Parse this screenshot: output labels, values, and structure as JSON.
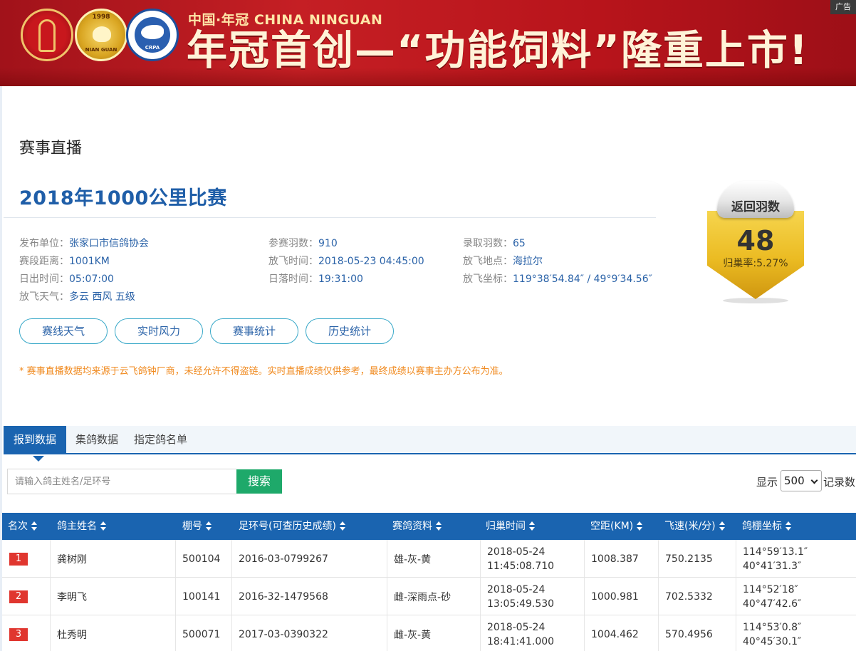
{
  "banner": {
    "subtitle": "中国·年冠 CHINA NINGUAN",
    "headline": "年冠首创—“功能饲料”隆重上市!",
    "ad_label": "广告",
    "logo2_year": "1998",
    "logo2_text": "NIAN GUAN",
    "logo3_text": "CRPA"
  },
  "section_title": "赛事直播",
  "race_title": "2018年1000公里比赛",
  "info": {
    "publisher_label": "发布单位：",
    "publisher": "张家口市信鸽协会",
    "entries_label": "参赛羽数：",
    "entries": "910",
    "winners_label": "录取羽数：",
    "winners": "65",
    "distance_label": "赛段距离：",
    "distance": "1001KM",
    "release_time_label": "放飞时间：",
    "release_time": "2018-05-23 04:45:00",
    "release_place_label": "放飞地点：",
    "release_place": "海拉尔",
    "sunrise_label": "日出时间：",
    "sunrise": "05:07:00",
    "sunset_label": "日落时间：",
    "sunset": "19:31:00",
    "coords_label": "放飞坐标：",
    "coords": "119°38′54.84″ / 49°9′34.56″",
    "weather_label": "放飞天气：",
    "weather": "多云 西风 五级"
  },
  "badge": {
    "label": "返回羽数",
    "count": "48",
    "rate": "归巢率:5.27%",
    "fill_percent": 5.27
  },
  "buttons": [
    "赛线天气",
    "实时风力",
    "赛事统计",
    "历史统计"
  ],
  "notice": "* 赛事直播数据均来源于云飞鸽钟厂商，未经允许不得盗链。实时直播成绩仅供参考，最终成绩以赛事主办方公布为准。",
  "tabs": [
    "报到数据",
    "集鸽数据",
    "指定鸽名单"
  ],
  "search": {
    "placeholder": "请输入鸽主姓名/足环号",
    "button": "搜索",
    "show_label": "显示",
    "show_value": "500",
    "records_label": "记录数"
  },
  "table": {
    "headers": [
      "名次",
      "鸽主姓名",
      "棚号",
      "足环号(可查历史成绩)",
      "赛鸽资料",
      "归巢时间",
      "空距(KM)",
      "飞速(米/分)",
      "鸽棚坐标"
    ],
    "rows": [
      {
        "rank": "1",
        "name": "龚树刚",
        "loft": "500104",
        "ring": "2016-03-0799267",
        "pigeon": "雄-灰-黄",
        "date": "2018-05-24",
        "time": "11:45:08.710",
        "distance": "1008.387",
        "speed": "750.2135",
        "lon": "114°59′13.1″",
        "lat": "40°41′31.3″"
      },
      {
        "rank": "2",
        "name": "李明飞",
        "loft": "100141",
        "ring": "2016-32-1479568",
        "pigeon": "雌-深雨点-砂",
        "date": "2018-05-24",
        "time": "13:05:49.530",
        "distance": "1000.981",
        "speed": "702.5332",
        "lon": "114°52′18″",
        "lat": "40°47′42.6″"
      },
      {
        "rank": "3",
        "name": "杜秀明",
        "loft": "500071",
        "ring": "2017-03-0390322",
        "pigeon": "雌-灰-黄",
        "date": "2018-05-24",
        "time": "18:41:41.000",
        "distance": "1004.462",
        "speed": "570.4956",
        "lon": "114°53′0.8″",
        "lat": "40°45′30.1″"
      }
    ]
  }
}
